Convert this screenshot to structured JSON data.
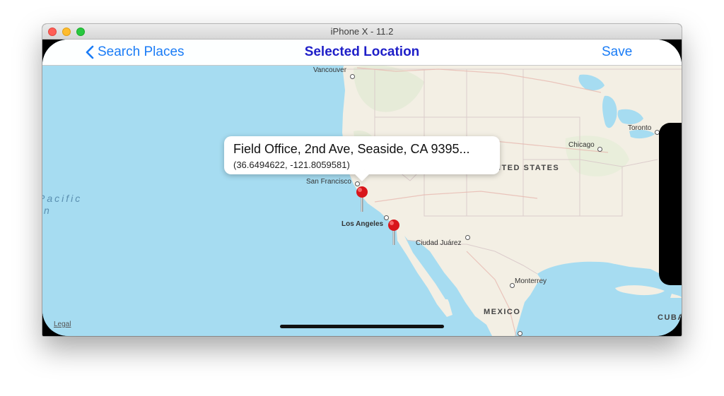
{
  "window": {
    "title": "iPhone X - 11.2"
  },
  "navbar": {
    "back_label": "Search Places",
    "title": "Selected Location",
    "save_label": "Save"
  },
  "callout": {
    "address": "Field Office, 2nd Ave, Seaside, CA 9395...",
    "coordinates": "(36.6494622, -121.8059581)"
  },
  "map": {
    "legal": "Legal",
    "countries": {
      "us": "UNITED STATES",
      "mexico": "MEXICO",
      "cuba": "CUBA"
    },
    "ocean": {
      "line1": "Pacific",
      "line2": "n"
    },
    "cities": {
      "vancouver": "Vancouver",
      "san_francisco": "San Francisco",
      "los_angeles": "Los Angeles",
      "ciudad_juarez": "Ciudad Juárez",
      "monterrey": "Monterrey",
      "chicago": "Chicago",
      "toronto": "Toronto"
    },
    "colors": {
      "water": "#a6dcf1",
      "land": "#f3efe4",
      "pin": "#d8161b",
      "accent": "#1a7cf6"
    }
  },
  "icons": {
    "back": "chevron-left-icon",
    "pin": "map-pin-icon"
  }
}
